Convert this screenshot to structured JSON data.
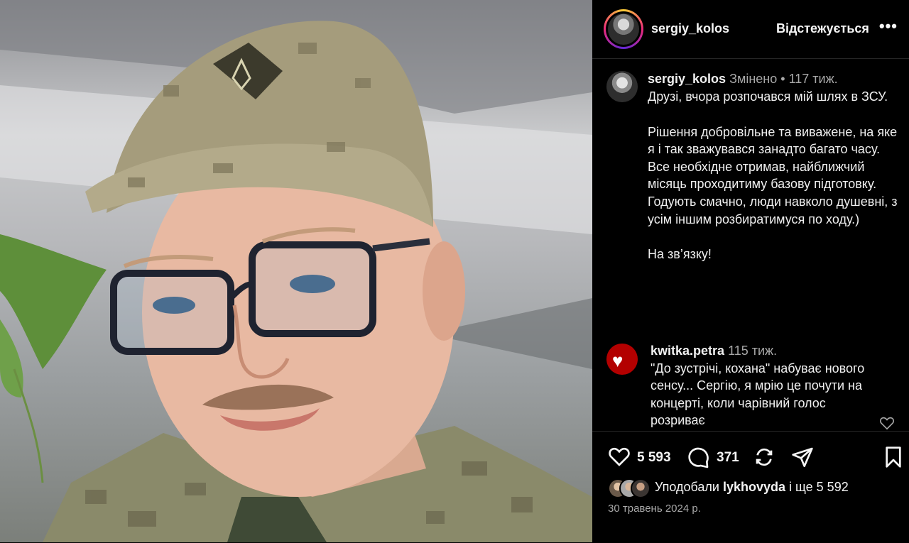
{
  "header": {
    "username": "sergiy_kolos",
    "follow_status": "Відстежується",
    "more": "•••"
  },
  "caption": {
    "username": "sergiy_kolos",
    "edited": "Змінено",
    "separator": "•",
    "time": "117 тиж.",
    "lines": [
      "Друзі, вчора розпочався мій шлях в ЗСУ.",
      "Рішення добровільне та виважене, на яке я і так зважувався занадто багато часу. Все необхідне отримав, найближчий місяць проходитиму базову підготовку. Годують смачно, люди навколо душевні, з усім іншим розбиратимуся по ходу.)",
      "На зв’язку!"
    ]
  },
  "comment": {
    "username": "kwitka.petra",
    "time": "115 тиж.",
    "text": "\"До зустрічі, кохана\" набуває нового сенсу... Сергію, я мрію це почути на концерті, коли чарівний голос розриває"
  },
  "actions": {
    "likes_count": "5 593",
    "comments_count": "371"
  },
  "likes": {
    "prefix": "Уподобали",
    "user": "lykhovyda",
    "suffix": "і ще 5 592"
  },
  "date": "30 травень 2024 р.",
  "icons": [
    "heart-icon",
    "comment-icon",
    "repost-icon",
    "share-icon",
    "bookmark-icon",
    "more-icon"
  ]
}
